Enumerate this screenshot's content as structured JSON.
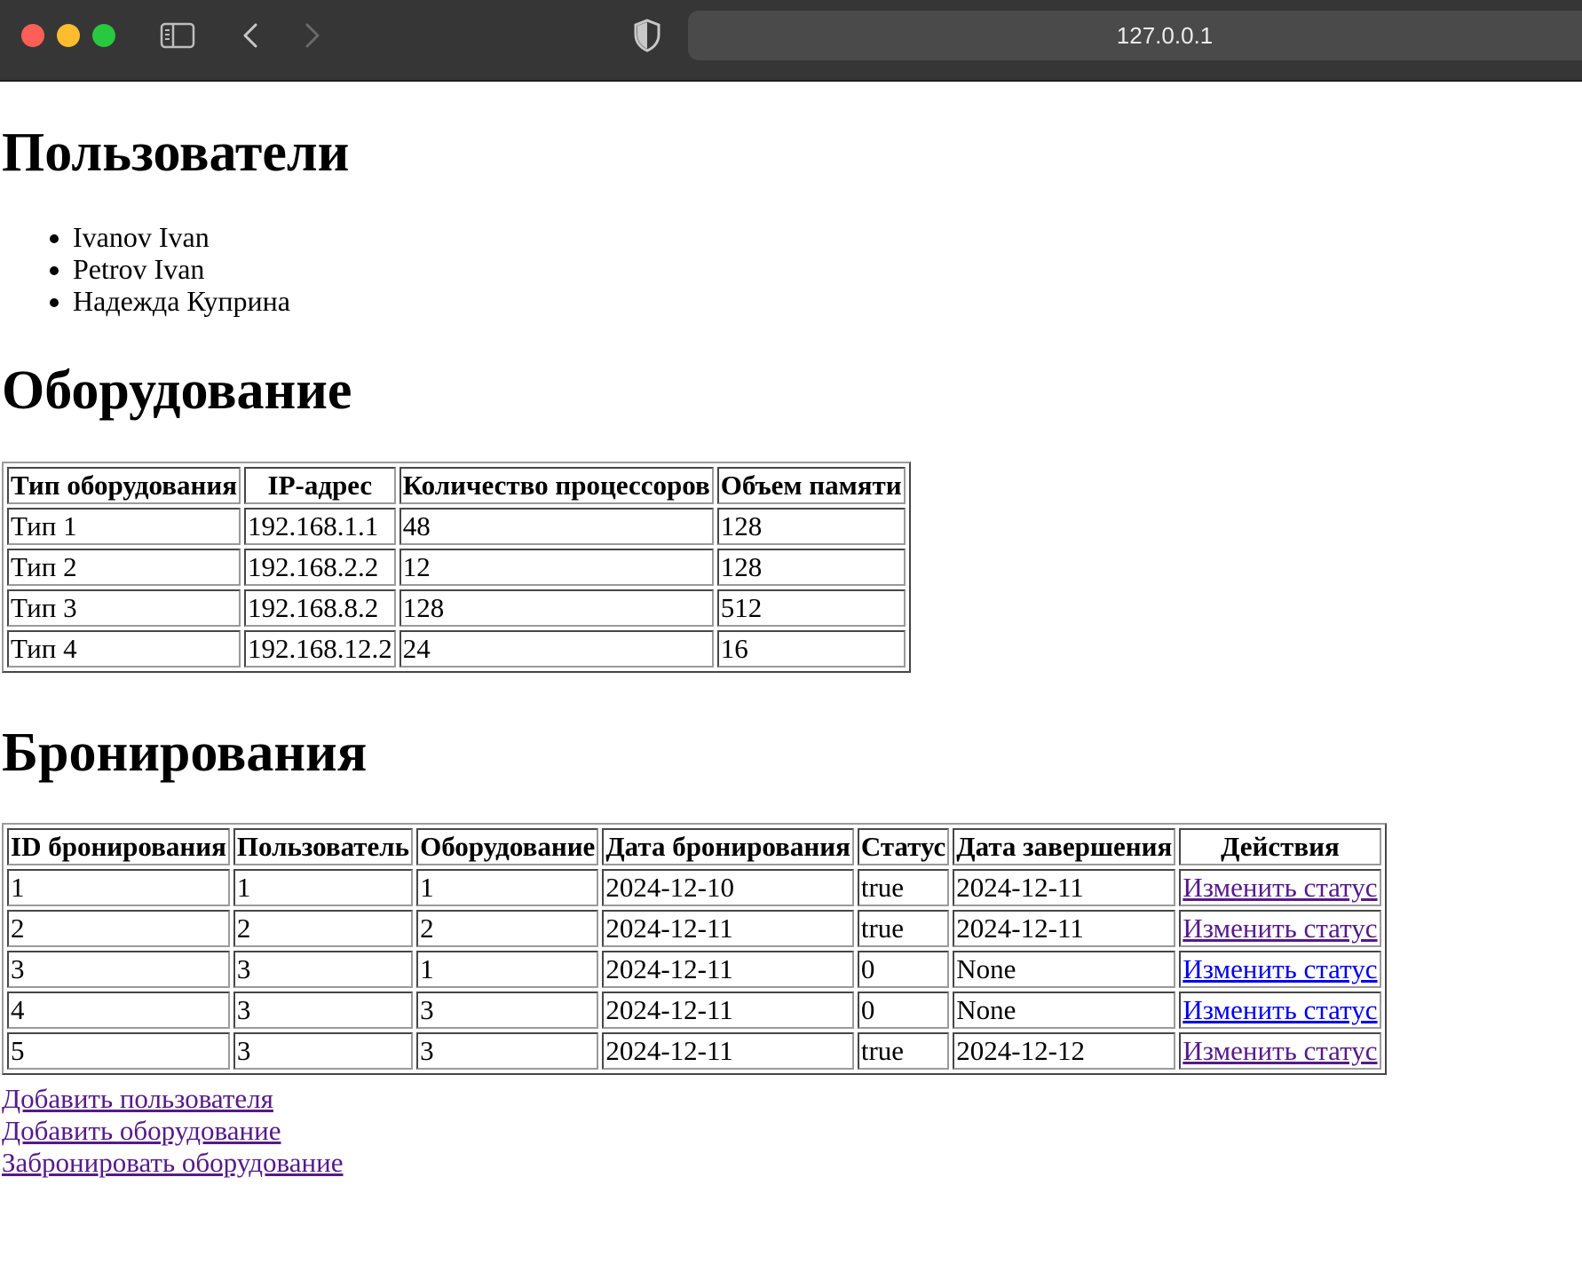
{
  "browser": {
    "url": "127.0.0.1"
  },
  "users": {
    "title": "Пользователи",
    "items": [
      "Ivanov Ivan",
      "Petrov Ivan",
      "Надежда Куприна"
    ]
  },
  "equipment": {
    "title": "Оборудование",
    "headers": [
      "Тип оборудования",
      "IP-адрес",
      "Количество процессоров",
      "Объем памяти"
    ],
    "rows": [
      [
        "Тип 1",
        "192.168.1.1",
        "48",
        "128"
      ],
      [
        "Тип 2",
        "192.168.2.2",
        "12",
        "128"
      ],
      [
        "Тип 3",
        "192.168.8.2",
        "128",
        "512"
      ],
      [
        "Тип 4",
        "192.168.12.2",
        "24",
        "16"
      ]
    ]
  },
  "bookings": {
    "title": "Бронирования",
    "headers": [
      "ID бронирования",
      "Пользователь",
      "Оборудование",
      "Дата бронирования",
      "Статус",
      "Дата завершения",
      "Действия"
    ],
    "rows": [
      [
        "1",
        "1",
        "1",
        "2024-12-10",
        "true",
        "2024-12-11",
        "Изменить статус"
      ],
      [
        "2",
        "2",
        "2",
        "2024-12-11",
        "true",
        "2024-12-11",
        "Изменить статус"
      ],
      [
        "3",
        "3",
        "1",
        "2024-12-11",
        "0",
        "None",
        "Изменить статус"
      ],
      [
        "4",
        "3",
        "3",
        "2024-12-11",
        "0",
        "None",
        "Изменить статус"
      ],
      [
        "5",
        "3",
        "3",
        "2024-12-11",
        "true",
        "2024-12-12",
        "Изменить статус"
      ]
    ]
  },
  "links": {
    "add_user": "Добавить пользователя",
    "add_equipment": "Добавить оборудование",
    "book_equipment": "Забронировать оборудование"
  }
}
